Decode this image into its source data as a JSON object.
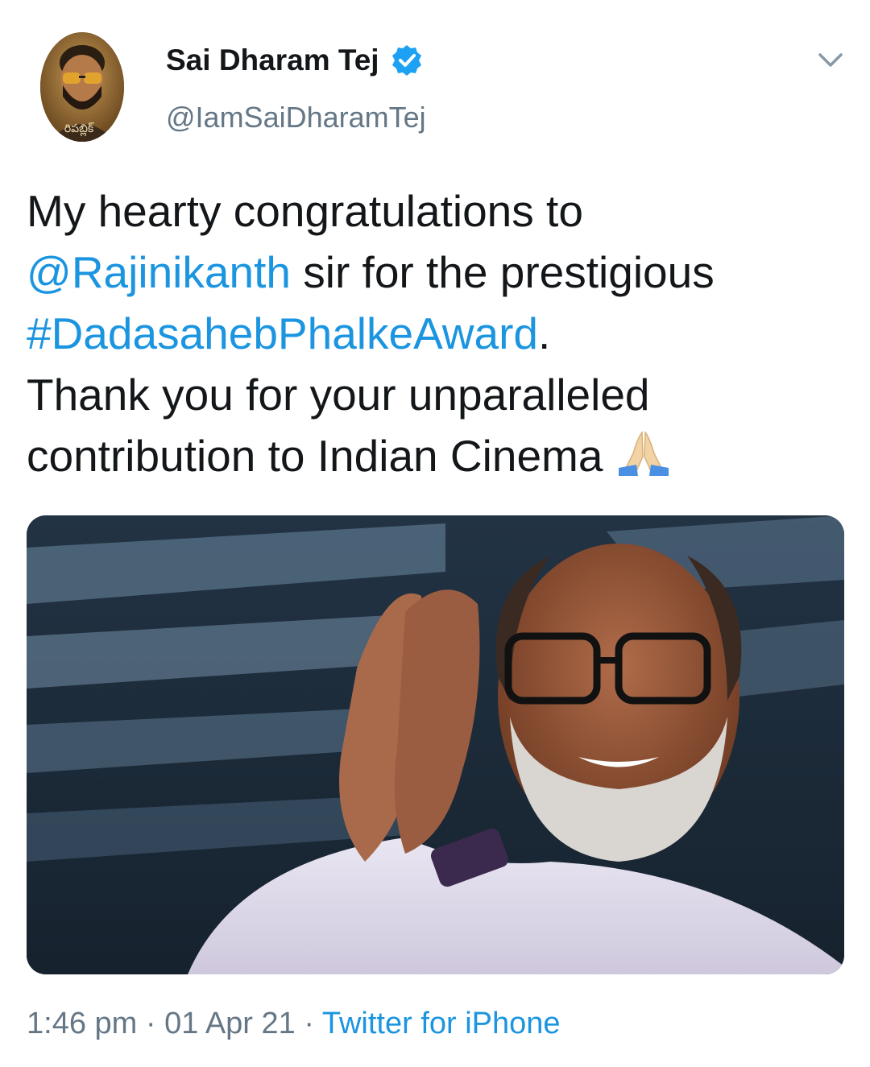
{
  "author": {
    "display_name": "Sai Dharam Tej",
    "handle": "@IamSaiDharamTej",
    "verified": true,
    "avatar_caption": "రిపబ్లిక్",
    "avatar_icon": "profile-avatar"
  },
  "menu": {
    "icon": "chevron-down-icon"
  },
  "tweet": {
    "line1": "My hearty congratulations to",
    "mention": "@Rajinikanth",
    "line2_rest": " sir for the prestigious",
    "hashtag": "#DadasahebPhalkeAward",
    "line3_rest": ".",
    "line4": "Thank you for your unparalleled",
    "line5": "contribution to Indian Cinema",
    "emoji": "folded-hands-emoji"
  },
  "media": {
    "description_icon": "photo-of-smiling-man-with-folded-hands"
  },
  "meta": {
    "time": "1:46 pm",
    "sep1": " · ",
    "date": "01 Apr 21",
    "sep2": " · ",
    "source": "Twitter for iPhone"
  },
  "colors": {
    "link": "#1b95e0",
    "secondary_text": "#657786",
    "primary_text": "#14171a",
    "verified_badge": "#1da1f2"
  }
}
